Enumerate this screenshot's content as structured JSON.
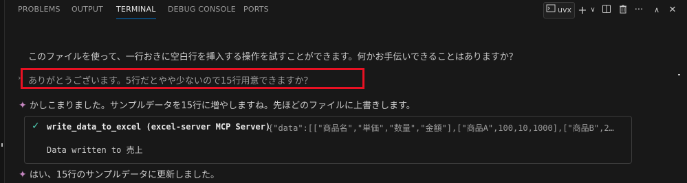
{
  "panel": {
    "tabs": [
      {
        "label": "PROBLEMS"
      },
      {
        "label": "OUTPUT"
      },
      {
        "label": "TERMINAL"
      },
      {
        "label": "DEBUG CONSOLE"
      },
      {
        "label": "PORTS"
      }
    ],
    "active_tab": "TERMINAL",
    "terminal_name": "uvx"
  },
  "colors": {
    "background": "#181818",
    "accent": "#0078d4",
    "sparkle": "#c586c0",
    "success": "#4ec9b0",
    "highlight_box": "#e81123"
  },
  "chat": {
    "line1": "このファイルを使って、一行おきに空白行を挿入する操作を試すことができます。何かお手伝いできることはありますか？",
    "user_prompt": "ありがとうございます。5行だとやや少ないので15行用意できますか？",
    "reply1": "かしこまりました。サンプルデータを15行に増やしますね。先ほどのファイルに上書きします。",
    "tool_call": {
      "name": "write_data_to_excel (excel-server MCP Server)",
      "args": "{\"data\":[[\"商品名\",\"単価\",\"数量\",\"金額\"],[\"商品A\",100,10,1000],[\"商品B\",2…",
      "result": "Data written to 売上"
    },
    "reply2": "はい、15行のサンプルデータに更新しました。"
  },
  "icons": {
    "terminal": "terminal-icon",
    "add": "plus-icon",
    "dropdown": "chevron-down-icon",
    "split": "split-terminal-icon",
    "kill": "trash-icon",
    "more": "ellipsis-icon",
    "maximize": "chevron-up-icon",
    "close": "close-icon",
    "sparkle": "sparkle-icon",
    "check": "check-icon"
  }
}
